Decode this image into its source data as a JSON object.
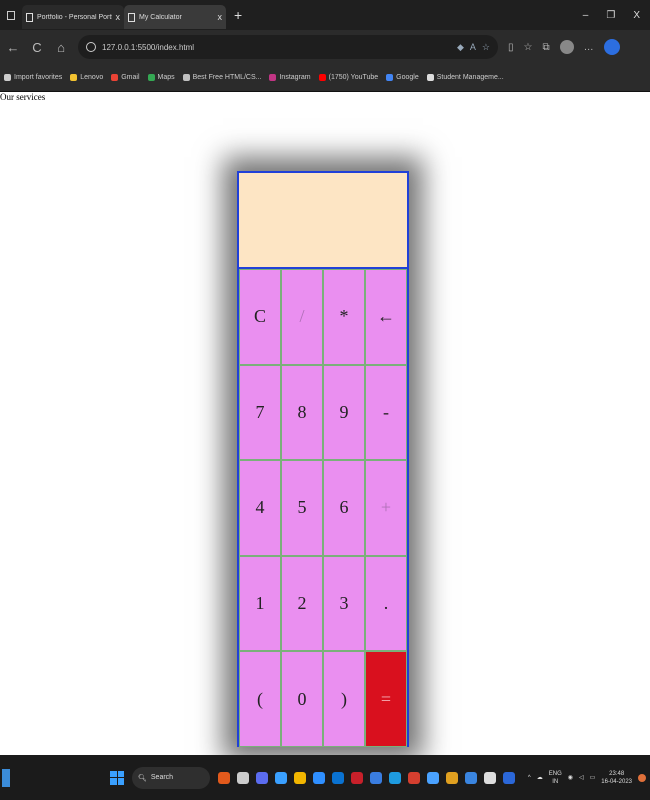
{
  "browser": {
    "tabs": [
      {
        "title": "Portfolio - Personal Portfolio Web",
        "active": false
      },
      {
        "title": "My Calculator",
        "active": true
      }
    ],
    "new_tab": "+",
    "window_controls": [
      "–",
      "❐",
      "X"
    ],
    "nav": {
      "back": "←",
      "reload": "C",
      "home": "⌂"
    },
    "url": "127.0.0.1:5500/index.html",
    "bookmarks": [
      {
        "label": "Import favorites",
        "color": "#cccccc"
      },
      {
        "label": "Lenovo",
        "color": "#f2c230"
      },
      {
        "label": "Gmail",
        "color": "#ea4335"
      },
      {
        "label": "Maps",
        "color": "#34a853"
      },
      {
        "label": "Best Free HTML/CS...",
        "color": "#c0c0c0"
      },
      {
        "label": "Instagram",
        "color": "#c13584"
      },
      {
        "label": "(1750) YouTube",
        "color": "#ff0000"
      },
      {
        "label": "Google",
        "color": "#4285f4"
      },
      {
        "label": "Student Manageme...",
        "color": "#dddddd"
      }
    ]
  },
  "page": {
    "text": "Our services"
  },
  "calculator": {
    "display_value": "",
    "keys": [
      {
        "label": "C",
        "name": "clear-key",
        "style": ""
      },
      {
        "label": "/",
        "name": "divide-key",
        "style": "faded"
      },
      {
        "label": "*",
        "name": "multiply-key",
        "style": ""
      },
      {
        "label": "←",
        "name": "backspace-key",
        "style": ""
      },
      {
        "label": "7",
        "name": "digit-7-key",
        "style": ""
      },
      {
        "label": "8",
        "name": "digit-8-key",
        "style": ""
      },
      {
        "label": "9",
        "name": "digit-9-key",
        "style": ""
      },
      {
        "label": "-",
        "name": "subtract-key",
        "style": ""
      },
      {
        "label": "4",
        "name": "digit-4-key",
        "style": ""
      },
      {
        "label": "5",
        "name": "digit-5-key",
        "style": ""
      },
      {
        "label": "6",
        "name": "digit-6-key",
        "style": ""
      },
      {
        "label": "+",
        "name": "add-key",
        "style": "faded"
      },
      {
        "label": "1",
        "name": "digit-1-key",
        "style": ""
      },
      {
        "label": "2",
        "name": "digit-2-key",
        "style": ""
      },
      {
        "label": "3",
        "name": "digit-3-key",
        "style": ""
      },
      {
        "label": ".",
        "name": "decimal-key",
        "style": ""
      },
      {
        "label": "(",
        "name": "open-paren-key",
        "style": ""
      },
      {
        "label": "0",
        "name": "digit-0-key",
        "style": ""
      },
      {
        "label": ")",
        "name": "close-paren-key",
        "style": ""
      },
      {
        "label": "=",
        "name": "equals-key",
        "style": "equals"
      }
    ],
    "colors": {
      "display_bg": "#fde5c4",
      "key_bg": "#ea8ff0",
      "equals_bg": "#d9101e",
      "border": "#2040d8"
    }
  },
  "taskbar": {
    "search_label": "Search",
    "apps": [
      "#e25a1c",
      "#cccccc",
      "#5b6cf0",
      "#3aa0ff",
      "#f2b600",
      "#2f8fff",
      "#0a72d1",
      "#c8202a",
      "#3a7de0",
      "#1e9be0",
      "#d43f2f",
      "#4aa2ff",
      "#e0a020",
      "#3a85e0",
      "#dddddd",
      "#2b67d8"
    ],
    "tray": {
      "lang_top": "ENG",
      "lang_bottom": "IN",
      "time": "23:48",
      "date": "16-04-2023"
    }
  }
}
